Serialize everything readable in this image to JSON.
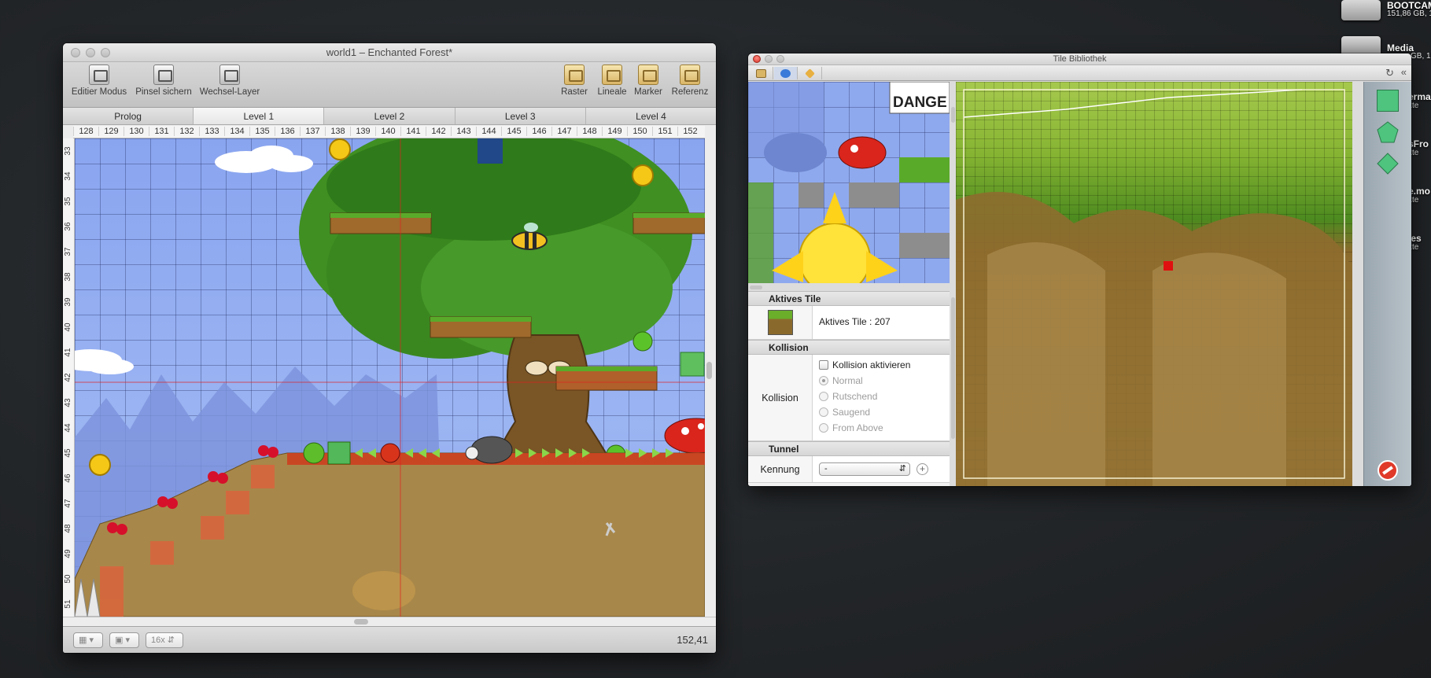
{
  "desktop": {
    "icons": [
      {
        "name": "BOOTCAM",
        "sub": "151,86 GB, 1"
      },
      {
        "name": "Media",
        "sub": "GB, 1"
      },
      {
        "name": "erma",
        "sub": "kte"
      },
      {
        "name": "sFro",
        "sub": "kte"
      },
      {
        "name": "e.mo",
        "sub": "kte"
      },
      {
        "name": "les",
        "sub": "kte"
      }
    ]
  },
  "editor": {
    "title": "world1 – Enchanted Forest*",
    "toolbar_left": [
      "Editier Modus",
      "Pinsel sichern",
      "Wechsel-Layer"
    ],
    "toolbar_right": [
      "Raster",
      "Lineale",
      "Marker",
      "Referenz"
    ],
    "tabs": [
      "Prolog",
      "Level 1",
      "Level 2",
      "Level 3",
      "Level 4"
    ],
    "active_tab": "Level 1",
    "columns": [
      "128",
      "129",
      "130",
      "131",
      "132",
      "133",
      "134",
      "135",
      "136",
      "137",
      "138",
      "139",
      "140",
      "141",
      "142",
      "143",
      "144",
      "145",
      "146",
      "147",
      "148",
      "149",
      "150",
      "151",
      "152"
    ],
    "rows": [
      "33",
      "34",
      "35",
      "36",
      "37",
      "38",
      "39",
      "40",
      "41",
      "42",
      "43",
      "44",
      "45",
      "46",
      "47",
      "48",
      "49",
      "50",
      "51"
    ],
    "danger_sign": "DANGE",
    "status": {
      "zoom": "16x",
      "coords": "152,41"
    }
  },
  "tilelib": {
    "title": "Tile Bibliothek",
    "sections": {
      "active_tile_header": "Aktives Tile",
      "active_tile_text": "Aktives Tile : 207",
      "collision_header": "Kollision",
      "collision_label": "Kollision",
      "collision_checkbox": "Kollision aktivieren",
      "collision_options": [
        "Normal",
        "Rutschend",
        "Saugend",
        "From Above"
      ],
      "collision_selected": "Normal",
      "tunnel_header": "Tunnel",
      "kennung_label": "Kennung",
      "kennung_value": "-"
    }
  },
  "colors": {
    "sky": "#8aa5f0",
    "grass": "#6fb02a",
    "dirt": "#a8874a",
    "selected_tile_marker": "#e01010"
  }
}
